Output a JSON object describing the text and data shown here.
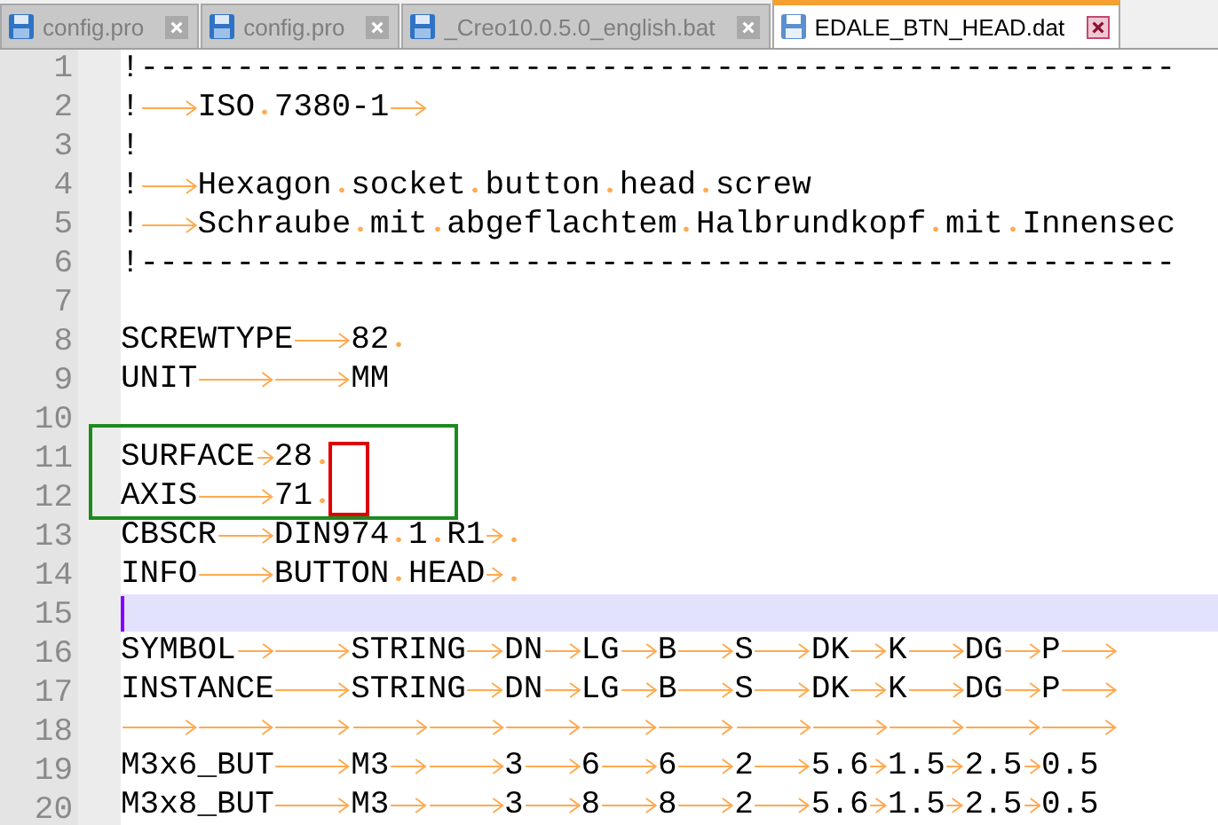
{
  "tabs": [
    {
      "label": "config.pro",
      "selected": false
    },
    {
      "label": "config.pro",
      "selected": false
    },
    {
      "label": "_Creo10.0.5.0_english.bat",
      "selected": false
    },
    {
      "label": "EDALE_BTN_HEAD.dat",
      "selected": true
    }
  ],
  "lines": [
    {
      "number": "1",
      "text": "!------------------------------------------------------",
      "current": false
    },
    {
      "number": "2",
      "text": "!\tISO 7380-1\t",
      "current": false
    },
    {
      "number": "3",
      "text": "!",
      "current": false
    },
    {
      "number": "4",
      "text": "!\tHexagon socket button head screw",
      "current": false
    },
    {
      "number": "5",
      "text": "!\tSchraube mit abgeflachtem Halbrundkopf mit Innensec",
      "current": false
    },
    {
      "number": "6",
      "text": "!------------------------------------------------------",
      "current": false
    },
    {
      "number": "7",
      "current": false
    },
    {
      "number": "8",
      "text": "SCREWTYPE\t82 ",
      "current": false
    },
    {
      "number": "9",
      "text": "UNIT\t\tMM",
      "current": false
    },
    {
      "number": "10",
      "current": false
    },
    {
      "number": "11",
      "text": "SURFACE\t28 ",
      "current": false
    },
    {
      "number": "12",
      "text": "AXIS\t71 ",
      "current": false
    },
    {
      "number": "13",
      "text": "CBSCR\tDIN974 1 R1\t ",
      "current": false
    },
    {
      "number": "14",
      "text": "INFO\tBUTTON HEAD\t ",
      "current": false
    },
    {
      "number": "15",
      "current": true
    },
    {
      "number": "16",
      "text": "SYMBOL\t\tSTRING\tDN\tLG\tB\tS\tDK\tK\tDG\tP\t",
      "current": false
    },
    {
      "number": "17",
      "text": "INSTANCE\tSTRING\tDN\tLG\tB\tS\tDK\tK\tDG\tP\t",
      "current": false
    },
    {
      "number": "18",
      "current": false,
      "marks": [
        {
          "kind": "tab"
        },
        {
          "kind": "tab"
        },
        {
          "kind": "tab"
        },
        {
          "kind": "tab"
        },
        {
          "kind": "tab"
        },
        {
          "kind": "tab"
        },
        {
          "kind": "tab"
        },
        {
          "kind": "tab"
        },
        {
          "kind": "tab"
        },
        {
          "kind": "tab"
        },
        {
          "kind": "tab"
        },
        {
          "kind": "tab"
        },
        {
          "kind": "tab"
        }
      ]
    },
    {
      "number": "19",
      "text": "M3x6_BUT\tM3\t\t3\t6\t6\t2\t5.6\t1.5\t2.5\t0.5",
      "current": false
    },
    {
      "number": "20",
      "text": "M3x8_BUT\tM3\t\t3\t8\t8\t2\t5.6\t1.5\t2.5\t0.5",
      "current": false
    }
  ],
  "annotations": [
    {
      "kind": "frame",
      "color": "#1e8a1e"
    },
    {
      "kind": "frame",
      "color": "#e00000"
    }
  ]
}
